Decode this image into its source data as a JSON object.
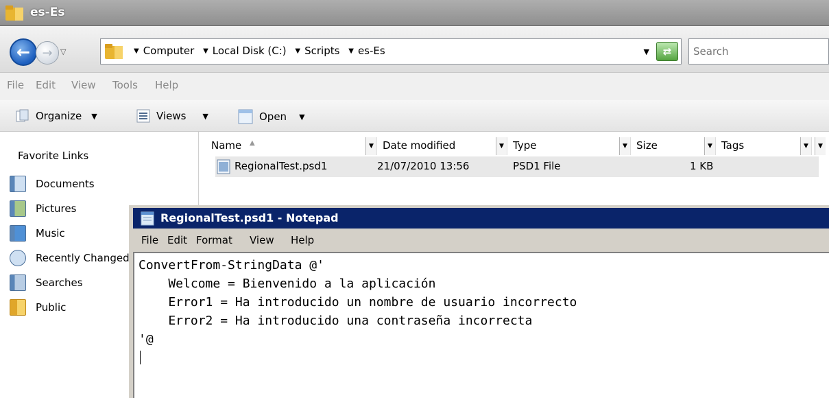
{
  "explorer": {
    "window_title": "es-Es",
    "address": {
      "crumbs": [
        "Computer",
        "Local Disk (C:)",
        "Scripts",
        "es-Es"
      ]
    },
    "search": {
      "placeholder": "Search"
    },
    "menu": [
      "File",
      "Edit",
      "View",
      "Tools",
      "Help"
    ],
    "toolbar": {
      "organize_label": "Organize",
      "views_label": "Views",
      "open_label": "Open"
    },
    "nav_pane": {
      "heading": "Favorite Links",
      "items": [
        {
          "label": "Documents",
          "icon": "documents-icon"
        },
        {
          "label": "Pictures",
          "icon": "pictures-icon"
        },
        {
          "label": "Music",
          "icon": "music-icon"
        },
        {
          "label": "Recently Changed",
          "icon": "recently-changed-icon"
        },
        {
          "label": "Searches",
          "icon": "searches-icon"
        },
        {
          "label": "Public",
          "icon": "folder-icon"
        }
      ]
    },
    "columns": [
      "Name",
      "Date modified",
      "Type",
      "Size",
      "Tags"
    ],
    "files": [
      {
        "name": "RegionalTest.psd1",
        "date_modified": "21/07/2010 13:56",
        "type": "PSD1 File",
        "size": "1 KB"
      }
    ]
  },
  "notepad": {
    "title": "RegionalTest.psd1 - Notepad",
    "menu": [
      "File",
      "Edit",
      "Format",
      "View",
      "Help"
    ],
    "content_lines": [
      "ConvertFrom-StringData @'",
      "    Welcome = Bienvenido a la aplicación",
      "    Error1 = Ha introducido un nombre de usuario incorrecto",
      "    Error2 = Ha introducido una contraseña incorrecta",
      "'@"
    ]
  },
  "colors": {
    "notepad_title_bar": "#0a246a",
    "explorer_title_bar": "#9c9c9c",
    "selected_row": "#e8e8e8"
  }
}
